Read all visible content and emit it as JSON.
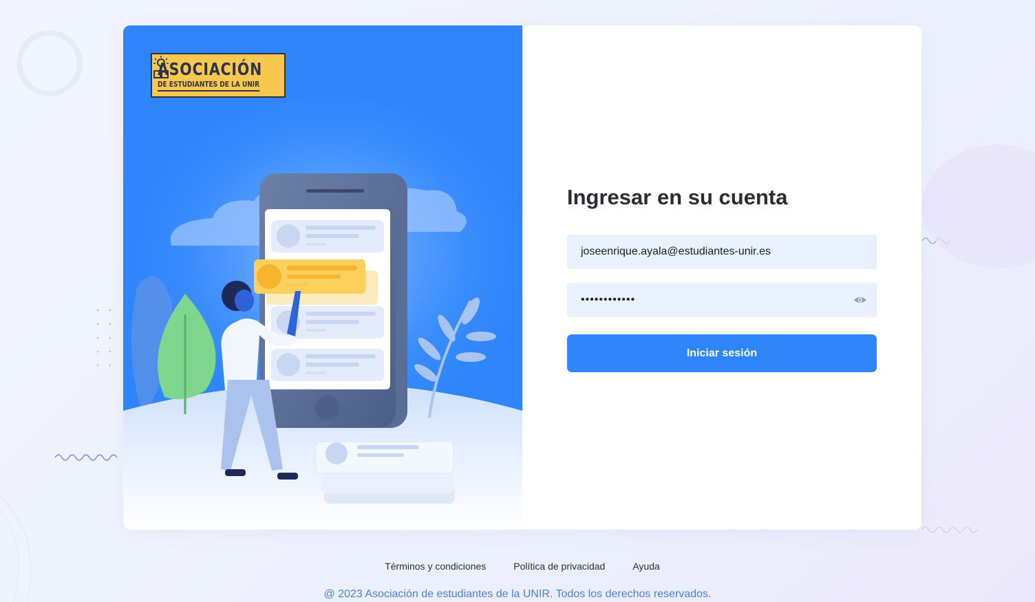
{
  "logo": {
    "title": "ASOCIACIÓN",
    "subtitle": "DE ESTUDIANTES DE LA UNIR"
  },
  "login": {
    "title": "Ingresar en su cuenta",
    "email_value": "joseenrique.ayala@estudiantes-unir.es",
    "password_value": "••••••••••••",
    "submit_label": "Iniciar sesión"
  },
  "footer": {
    "links": [
      "Términos y condiciones",
      "Política de privacidad",
      "Ayuda"
    ],
    "copyright": "@ 2023  Asociación de estudiantes de la UNIR. Todos los derechos reservados."
  },
  "colors": {
    "primary": "#2f86fc",
    "input_bg": "#e9f0fe",
    "logo_bg": "#f8c84e",
    "copyright_text": "#4a7fe0"
  },
  "icons": {
    "password_toggle": "eye-icon"
  }
}
